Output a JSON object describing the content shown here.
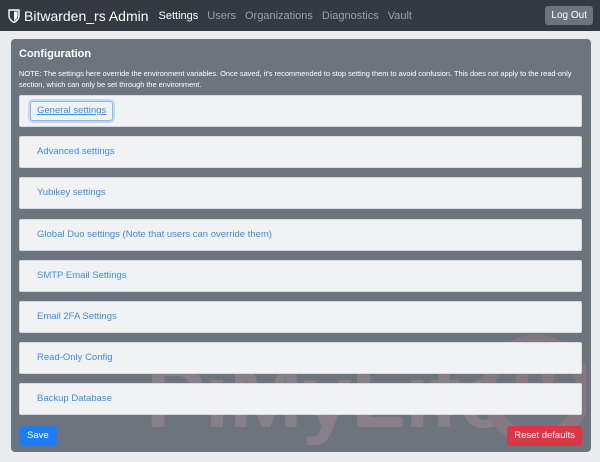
{
  "navbar": {
    "brand": "Bitwarden_rs Admin",
    "links": [
      {
        "label": "Settings",
        "active": true
      },
      {
        "label": "Users"
      },
      {
        "label": "Organizations"
      },
      {
        "label": "Diagnostics"
      },
      {
        "label": "Vault"
      }
    ],
    "logout_label": "Log Out"
  },
  "config": {
    "title": "Configuration",
    "note": "NOTE: The settings here override the environment variables. Once saved, it's recommended to stop setting them to avoid confusion. This does not apply to the read-only section, which can only be set through the environment.",
    "sections": [
      {
        "label": "General settings"
      },
      {
        "label": "Advanced settings"
      },
      {
        "label": "Yubikey settings"
      },
      {
        "label": "Global Duo settings (Note that users can override them)"
      },
      {
        "label": "SMTP Email Settings"
      },
      {
        "label": "Email 2FA Settings"
      },
      {
        "label": "Read-Only Config"
      },
      {
        "label": "Backup Database"
      }
    ],
    "save_label": "Save",
    "reset_label": "Reset defaults"
  },
  "watermark": {
    "text": "PiMyLife"
  },
  "colors": {
    "navbar_bg": "#343a40",
    "card_bg": "#6c757d",
    "link": "#3b8ded",
    "primary": "#1e7cf2",
    "danger": "#dc3545"
  }
}
